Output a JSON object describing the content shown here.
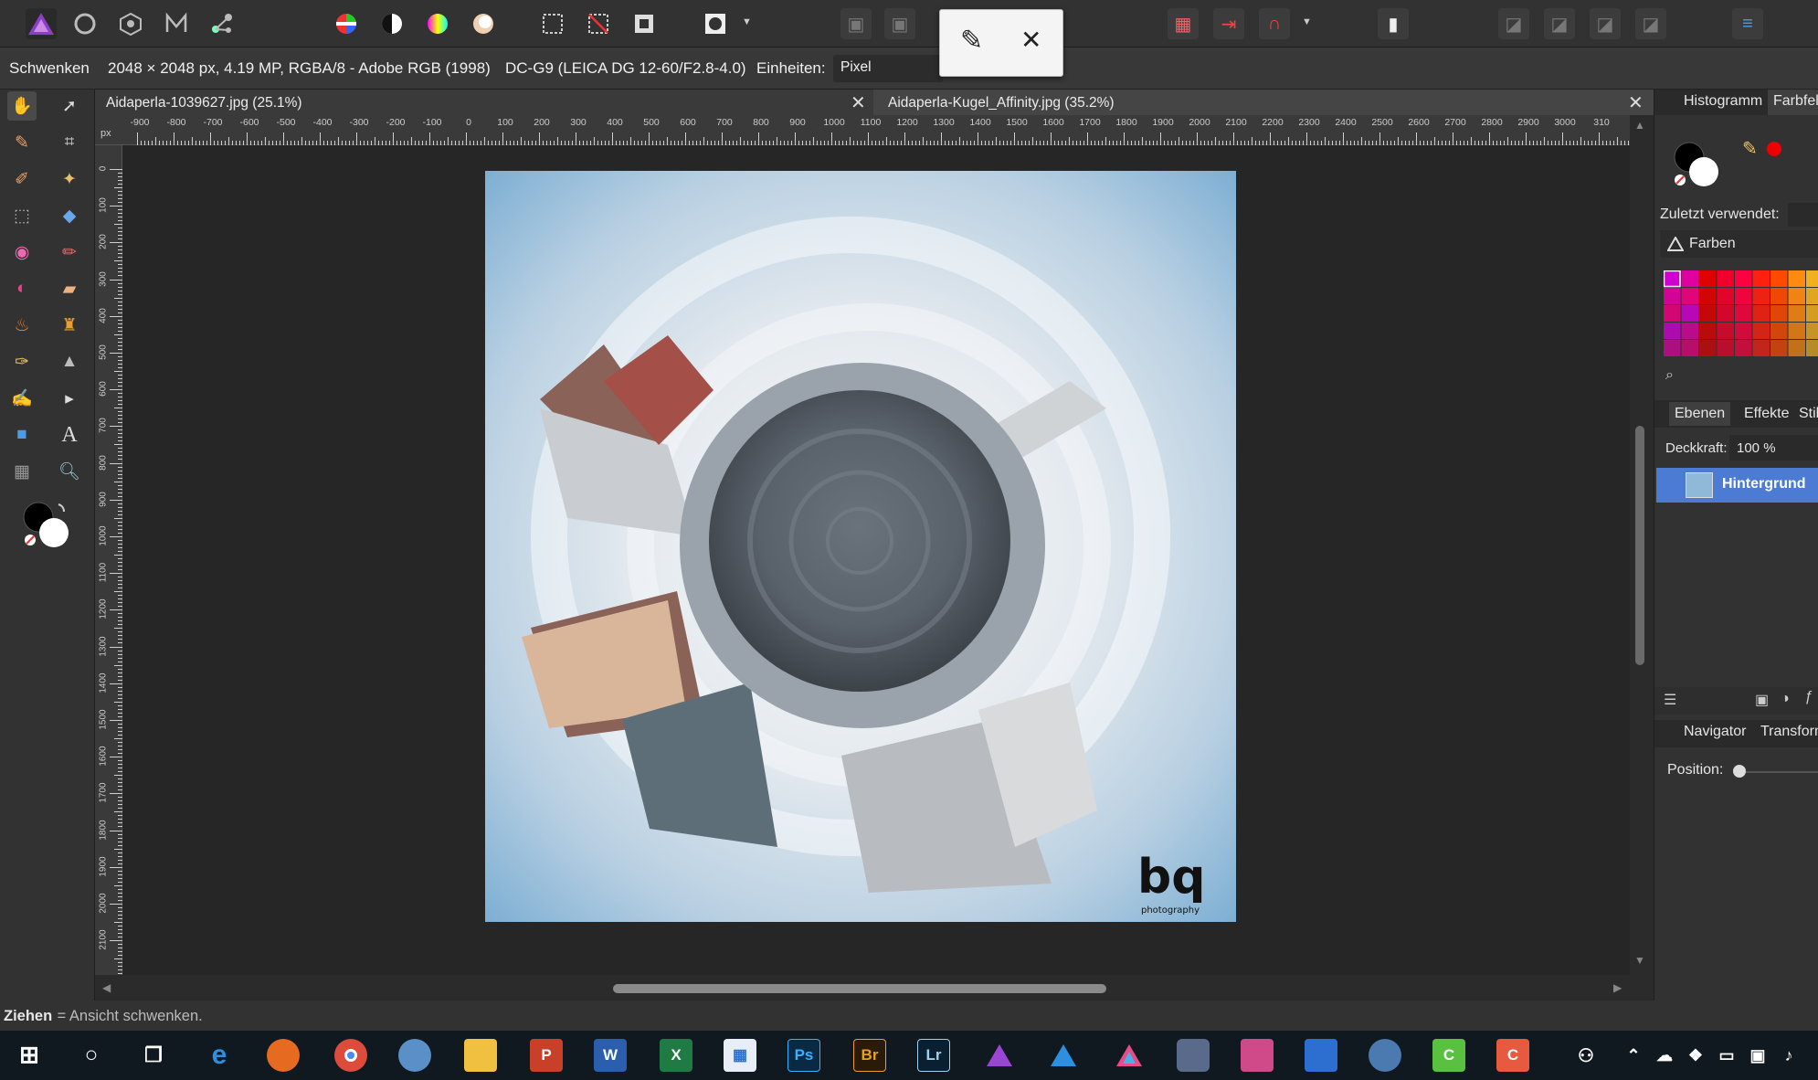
{
  "toolbar": {
    "icons": [
      "affinity-photo-logo-icon",
      "photo-persona-icon",
      "liquify-persona-icon",
      "develop-persona-icon",
      "export-persona-icon",
      "color-wheel-icon",
      "contrast-icon",
      "hue-icon",
      "white-balance-icon",
      "marquee-icon",
      "deselect-icon",
      "invert-selection-icon",
      "mask-icon",
      "assistant-icon"
    ]
  },
  "popup": {
    "pencil_icon": "✎",
    "close_icon": "✕"
  },
  "context": {
    "tool_name": "Schwenken",
    "doc_info": "2048 × 2048 px, 4.19 MP, RGBA/8 - Adobe RGB (1998)",
    "camera": "DC-G9 (LEICA DG 12-60/F2.8-4.0)",
    "units_label": "Einheiten:",
    "units_value": "Pixel"
  },
  "tabs": [
    {
      "label": "Aidaperla-1039627.jpg (25.1%)"
    },
    {
      "label": "Aidaperla-Kugel_Affinity.jpg (35.2%)"
    }
  ],
  "ruler": {
    "unit": "px",
    "top_labels": [
      "-900",
      "-800",
      "-700",
      "-600",
      "-500",
      "-400",
      "-300",
      "-200",
      "-100",
      "0",
      "100",
      "200",
      "300",
      "400",
      "500",
      "600",
      "700",
      "800",
      "900",
      "1000",
      "1100",
      "1200",
      "1300",
      "1400",
      "1500",
      "1600",
      "1700",
      "1800",
      "1900",
      "2000",
      "2100",
      "2200",
      "2300",
      "2400",
      "2500",
      "2600",
      "2700",
      "2800",
      "2900",
      "3000",
      "310"
    ],
    "left_labels": [
      "0",
      "100",
      "200",
      "300",
      "400",
      "500",
      "600",
      "700",
      "800",
      "900",
      "1000",
      "1100",
      "1200",
      "1300",
      "1400",
      "1500",
      "1600",
      "1700",
      "1800",
      "1900",
      "2000",
      "2100"
    ]
  },
  "image": {
    "watermark_text": "bq",
    "watermark_sub": "photography"
  },
  "right_panel": {
    "tabs": [
      "Histogramm",
      "Farbfel"
    ],
    "recent_label": "Zuletzt verwendet:",
    "palette_name": "Farben",
    "layer_tabs": [
      "Ebenen",
      "Effekte",
      "Stil"
    ],
    "opacity_label": "Deckkraft:",
    "opacity_value": "100 %",
    "layer_name": "Hintergrund",
    "nav_tabs": [
      "Navigator",
      "Transform"
    ],
    "position_label": "Position:"
  },
  "status": {
    "bold": "Ziehen",
    "text": " = Ansicht schwenken."
  },
  "taskbar": {
    "apps": [
      "P",
      "W",
      "X",
      "Ps",
      "Br",
      "Lr"
    ]
  },
  "colors": {
    "accent": "#4c7bd3",
    "foreground": "#000000",
    "background": "#ffffff",
    "sky": "#8fb9d6"
  }
}
